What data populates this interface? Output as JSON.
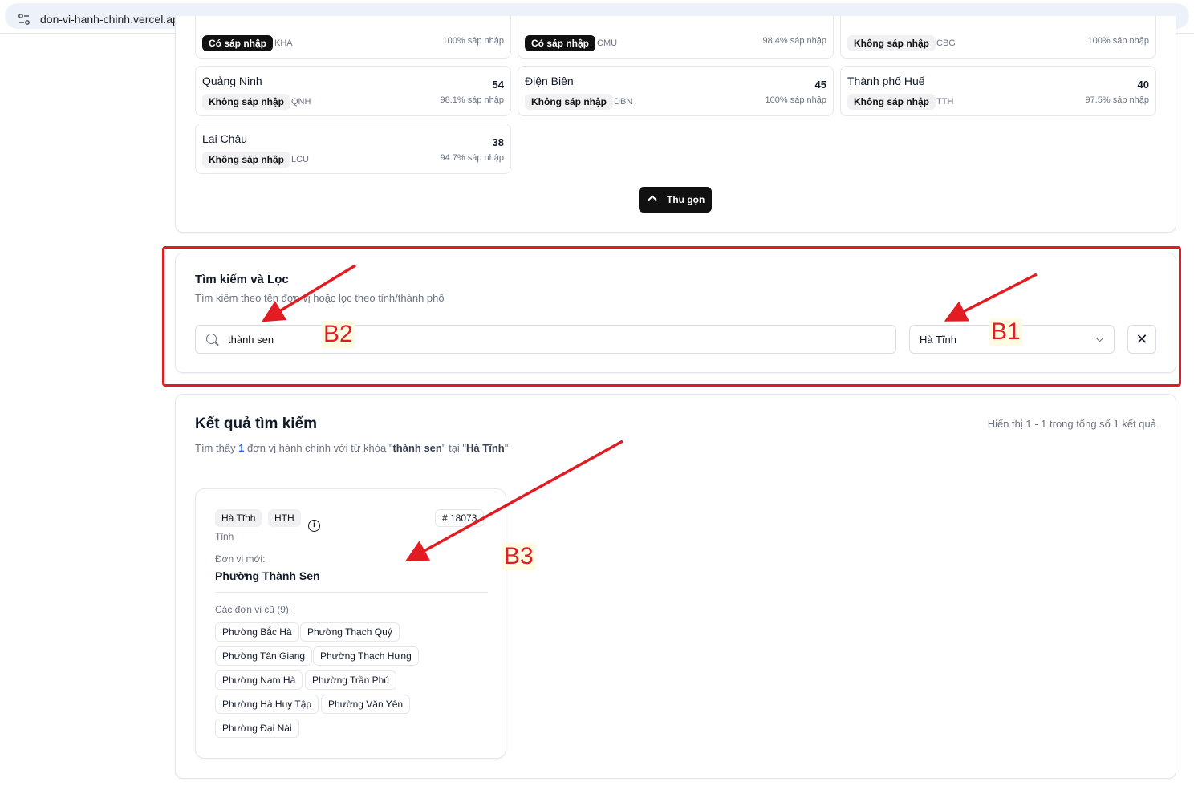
{
  "browser": {
    "url": "don-vi-hanh-chinh.vercel.app"
  },
  "provinces": [
    {
      "name": "",
      "count": "",
      "merge_label": "Có sáp nhập",
      "merge_style": "dark",
      "code": "KHA",
      "pct": "100% sáp nhập"
    },
    {
      "name": "",
      "count": "",
      "merge_label": "Có sáp nhập",
      "merge_style": "dark",
      "code": "CMU",
      "pct": "98.4% sáp nhập"
    },
    {
      "name": "",
      "count": "",
      "merge_label": "Không sáp nhập",
      "merge_style": "light",
      "code": "CBG",
      "pct": "100% sáp nhập"
    },
    {
      "name": "Quảng Ninh",
      "count": "54",
      "merge_label": "Không sáp nhập",
      "merge_style": "light",
      "code": "QNH",
      "pct": "98.1% sáp nhập"
    },
    {
      "name": "Điện Biên",
      "count": "45",
      "merge_label": "Không sáp nhập",
      "merge_style": "light",
      "code": "DBN",
      "pct": "100% sáp nhập"
    },
    {
      "name": "Thành phố Huế",
      "count": "40",
      "merge_label": "Không sáp nhập",
      "merge_style": "light",
      "code": "TTH",
      "pct": "97.5% sáp nhập"
    },
    {
      "name": "Lai Châu",
      "count": "38",
      "merge_label": "Không sáp nhập",
      "merge_style": "light",
      "code": "LCU",
      "pct": "94.7% sáp nhập"
    }
  ],
  "collapse_button": {
    "label": "Thu gọn"
  },
  "filter": {
    "title": "Tìm kiếm và Lọc",
    "subtitle": "Tìm kiếm theo tên đơn vị hoặc lọc theo tỉnh/thành phố",
    "search_value": "thành sen",
    "province_selected": "Hà Tĩnh",
    "clear_label": "✕"
  },
  "annotations": {
    "b1": "B1",
    "b2": "B2",
    "b3": "B3",
    "color": "#e31b23"
  },
  "results": {
    "title": "Kết quả tìm kiếm",
    "summary_prefix": "Tìm thấy ",
    "summary_count": "1",
    "summary_mid": " đơn vị hành chính với từ khóa \"",
    "summary_keyword": "thành sen",
    "summary_mid2": "\" tại \"",
    "summary_province": "Hà Tĩnh",
    "summary_end": "\"",
    "range": "Hiển thị 1 - 1 trong tổng số 1 kết quả"
  },
  "result_card": {
    "province": "Hà Tĩnh",
    "province_code": "HTH",
    "id": "# 18073",
    "province_type": "Tỉnh",
    "new_unit_label": "Đơn vị mới:",
    "new_unit": "Phường Thành Sen",
    "old_units_label": "Các đơn vị cũ (9):",
    "old_units": [
      "Phường Bắc Hà",
      "Phường Thạch Quý",
      "Phường Tân Giang",
      "Phường Thạch Hưng",
      "Phường Nam Hà",
      "Phường Trần Phú",
      "Phường Hà Huy Tập",
      "Phường Văn Yên",
      "Phường Đại Nài"
    ]
  }
}
